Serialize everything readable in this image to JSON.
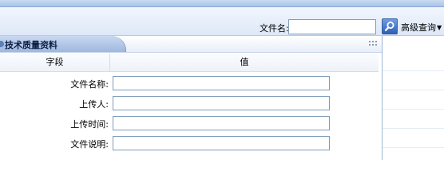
{
  "toolbar": {
    "filename_label": "文件名:",
    "filename_value": "",
    "advanced_query_label": "高级查询"
  },
  "panel": {
    "title": "技术质量资料",
    "columns": {
      "field": "字段",
      "value": "值"
    },
    "rows": [
      {
        "label": "文件名称:",
        "value": ""
      },
      {
        "label": "上传人:",
        "value": ""
      },
      {
        "label": "上传时间:",
        "value": ""
      },
      {
        "label": "文件说明:",
        "value": ""
      }
    ]
  },
  "icons": {
    "search": "search-icon",
    "dropdown": "chevron-down-icon",
    "grip": "grip-icon"
  },
  "colors": {
    "header_blue": "#a9c2e6",
    "input_border": "#7f9db9",
    "button_blue": "#2d5fb6"
  }
}
